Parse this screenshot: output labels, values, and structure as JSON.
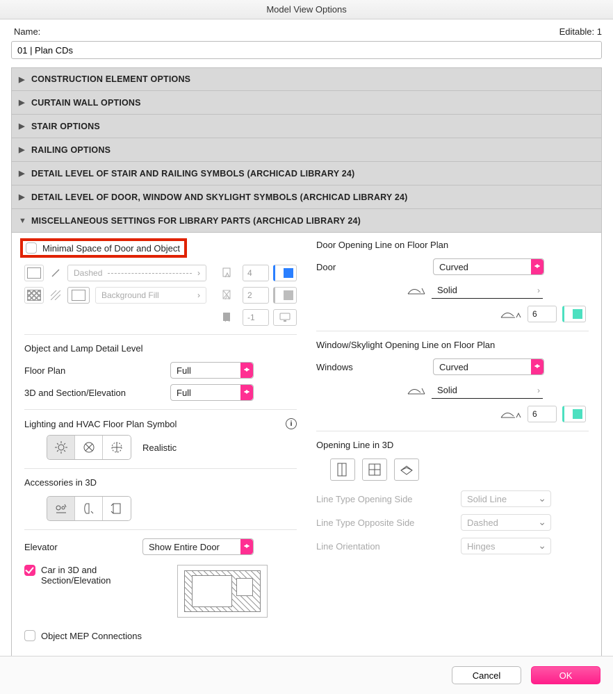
{
  "window": {
    "title": "Model View Options"
  },
  "header": {
    "name_label": "Name:",
    "editable_label": "Editable: 1",
    "name_value": "01 | Plan CDs"
  },
  "sections": {
    "s1": "CONSTRUCTION ELEMENT OPTIONS",
    "s2": "CURTAIN WALL OPTIONS",
    "s3": "STAIR OPTIONS",
    "s4": "RAILING OPTIONS",
    "s5": "DETAIL LEVEL OF STAIR AND RAILING SYMBOLS (ARCHICAD LIBRARY 24)",
    "s6": "DETAIL LEVEL OF DOOR, WINDOW AND SKYLIGHT SYMBOLS (ARCHICAD LIBRARY 24)",
    "s7": "MISCELLANEOUS SETTINGS FOR LIBRARY PARTS (ARCHICAD LIBRARY 24)"
  },
  "left": {
    "minimal_space_label": "Minimal Space of Door and Object",
    "dashed_label": "Dashed",
    "bg_fill_label": "Background Fill",
    "pen1": "4",
    "pen2": "2",
    "pen3": "-1",
    "obj_lamp_title": "Object and Lamp Detail Level",
    "floorplan_label": "Floor Plan",
    "floorplan_value": "Full",
    "sec_label": "3D and Section/Elevation",
    "sec_value": "Full",
    "lighting_title": "Lighting and HVAC Floor Plan Symbol",
    "lighting_mode": "Realistic",
    "acc_title": "Accessories in 3D",
    "elevator_label": "Elevator",
    "elevator_value": "Show Entire Door",
    "car3d_label": "Car in 3D and Section/Elevation",
    "mep_label": "Object MEP Connections"
  },
  "right": {
    "door_title": "Door Opening Line on Floor Plan",
    "door_label": "Door",
    "door_value": "Curved",
    "door_linetype": "Solid",
    "door_pen": "6",
    "win_title": "Window/Skylight Opening Line on Floor Plan",
    "win_label": "Windows",
    "win_value": "Curved",
    "win_linetype": "Solid",
    "win_pen": "6",
    "open3d_title": "Opening Line in 3D",
    "lt_open_label": "Line Type Opening Side",
    "lt_open_value": "Solid Line",
    "lt_opp_label": "Line Type Opposite Side",
    "lt_opp_value": "Dashed",
    "orient_label": "Line Orientation",
    "orient_value": "Hinges"
  },
  "footer": {
    "cancel": "Cancel",
    "ok": "OK"
  }
}
